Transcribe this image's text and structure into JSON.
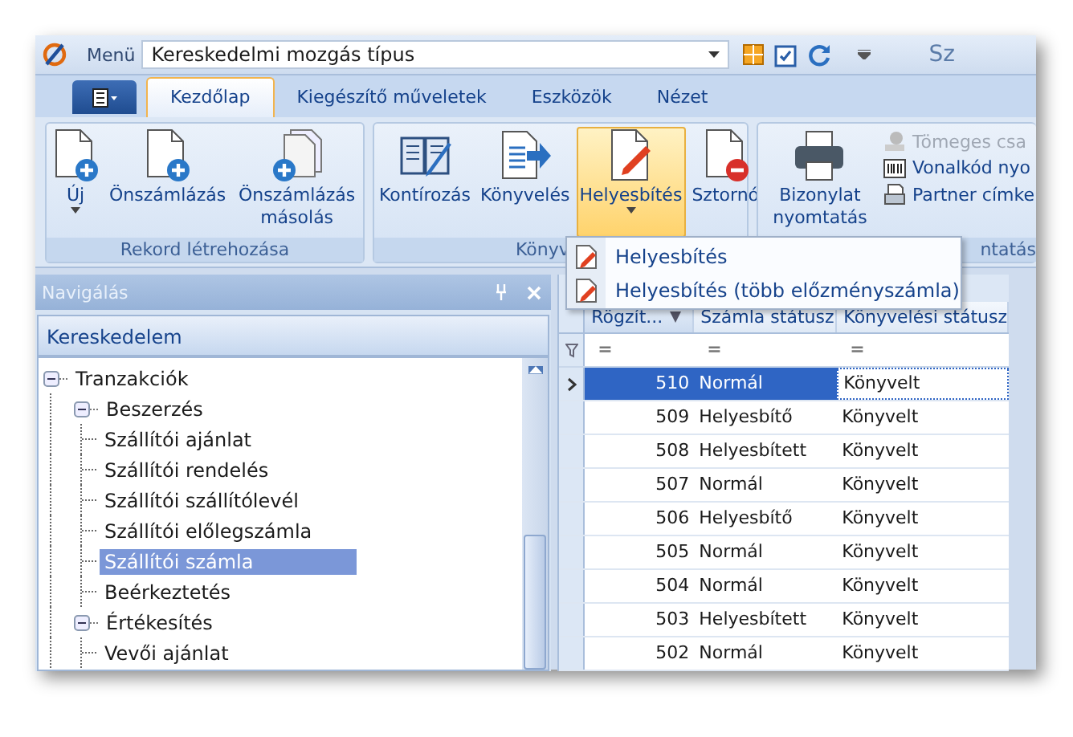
{
  "title_bar": {
    "menu_label": "Menü",
    "menu_value": "Kereskedelmi mozgás típus",
    "title": "Sz"
  },
  "ribbon_tabs": [
    {
      "label": "Kezdőlap",
      "selected": true
    },
    {
      "label": "Kiegészítő műveletek",
      "selected": false
    },
    {
      "label": "Eszközök",
      "selected": false
    },
    {
      "label": "Nézet",
      "selected": false
    }
  ],
  "ribbon_groups": [
    {
      "label": "Rekord létrehozása",
      "buttons": [
        {
          "label": "Új",
          "kind": "new",
          "dropdown": true,
          "open": false
        },
        {
          "label": "Önszámlázás",
          "kind": "new",
          "dropdown": false,
          "open": false
        },
        {
          "label": "Önszámlázás másolás",
          "kind": "copy",
          "dropdown": false,
          "open": false
        }
      ]
    },
    {
      "label": "Könyv",
      "buttons": [
        {
          "label": "Kontírozás",
          "kind": "book",
          "dropdown": false,
          "open": false
        },
        {
          "label": "Könyvelés",
          "kind": "post",
          "dropdown": false,
          "open": false
        },
        {
          "label": "Helyesbítés",
          "kind": "edit",
          "dropdown": true,
          "open": true
        },
        {
          "label": "Sztornó",
          "kind": "cancel",
          "dropdown": false,
          "open": false
        }
      ]
    },
    {
      "label": "ntatás",
      "buttons": [
        {
          "label": "Bizonylat nyomtatás",
          "kind": "print",
          "dropdown": false,
          "open": false
        }
      ],
      "small_buttons": [
        {
          "label": "Tömeges csa",
          "kind": "stamp",
          "disabled": true
        },
        {
          "label": "Vonalkód nyo",
          "kind": "barcode",
          "disabled": false
        },
        {
          "label": "Partner címke",
          "kind": "label",
          "disabled": false
        }
      ]
    }
  ],
  "dropdown_menu": {
    "items": [
      {
        "label": "Helyesbítés"
      },
      {
        "label": "Helyesbítés (több előzményszámla)"
      }
    ]
  },
  "navigation": {
    "title": "Navigálás",
    "section": "Kereskedelem",
    "tree": [
      {
        "label": "Tranzakciók",
        "expanded": true,
        "selected": false,
        "children": [
          {
            "label": "Beszerzés",
            "expanded": true,
            "selected": false,
            "children": [
              {
                "label": "Szállítói ajánlat",
                "selected": false
              },
              {
                "label": "Szállítói rendelés",
                "selected": false
              },
              {
                "label": "Szállítói szállítólevél",
                "selected": false
              },
              {
                "label": "Szállítói előlegszámla",
                "selected": false
              },
              {
                "label": "Szállítói számla",
                "selected": true
              },
              {
                "label": "Beérkeztetés",
                "selected": false
              }
            ]
          },
          {
            "label": "Értékesítés",
            "expanded": true,
            "selected": false,
            "children": [
              {
                "label": "Vevői ajánlat",
                "selected": false
              }
            ]
          }
        ]
      }
    ]
  },
  "grid": {
    "columns": [
      {
        "label": "Rögzít...",
        "sorted": true
      },
      {
        "label": "Számla státusz",
        "sorted": false
      },
      {
        "label": "Könyvelési státusz",
        "sorted": false
      }
    ],
    "filter": [
      "=",
      "=",
      "="
    ],
    "rows": [
      {
        "cells": [
          "510",
          "Normál",
          "Könyvelt"
        ],
        "selected": true
      },
      {
        "cells": [
          "509",
          "Helyesbítő",
          "Könyvelt"
        ],
        "selected": false
      },
      {
        "cells": [
          "508",
          "Helyesbített",
          "Könyvelt"
        ],
        "selected": false
      },
      {
        "cells": [
          "507",
          "Normál",
          "Könyvelt"
        ],
        "selected": false
      },
      {
        "cells": [
          "506",
          "Helyesbítő",
          "Könyvelt"
        ],
        "selected": false
      },
      {
        "cells": [
          "505",
          "Normál",
          "Könyvelt"
        ],
        "selected": false
      },
      {
        "cells": [
          "504",
          "Normál",
          "Könyvelt"
        ],
        "selected": false
      },
      {
        "cells": [
          "503",
          "Helyesbített",
          "Könyvelt"
        ],
        "selected": false
      },
      {
        "cells": [
          "502",
          "Normál",
          "Könyvelt"
        ],
        "selected": false
      }
    ]
  }
}
